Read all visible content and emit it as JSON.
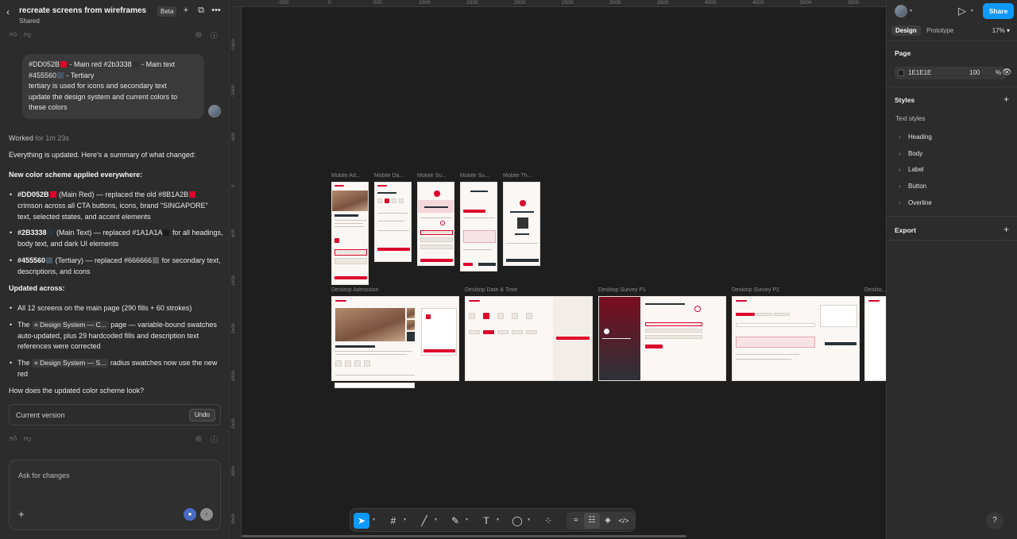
{
  "chat": {
    "title": "recreate screens from wireframes",
    "subtitle": "Shared",
    "beta": "Beta",
    "user_message": {
      "line1_a": "#DD052B",
      "line1_b": " - Main red #2b3338",
      "line1_c": " - Main text",
      "line2_a": "#455560",
      "line2_b": " - Tertiary",
      "line3": "tertiary is used for icons and secondary text",
      "line4": "update the design system and current colors to",
      "line5": "these colors"
    },
    "worked": "Worked",
    "worked_time": "for 1m 23s",
    "intro": "Everything is updated. Here's a summary of what changed:",
    "heading1": "New color scheme applied everywhere:",
    "bullets1": [
      {
        "code": "#DD052B",
        "text": " (Main Red) — replaced the old #8B1A2B",
        "tail": " crimson across all CTA buttons, icons, brand \"SINGAPORE\" text, selected states, and accent elements"
      },
      {
        "code": "#2B3338",
        "text": " (Main Text) — replaced #1A1A1A",
        "tail": " for all headings, body text, and dark UI elements"
      },
      {
        "code": "#455560",
        "text": " (Tertiary) — replaced #666666",
        "tail": " for secondary text, descriptions, and icons"
      }
    ],
    "heading2": "Updated across:",
    "bullets2": [
      {
        "pre": "All 12 screens on the main page (290 fills + 60 strokes)",
        "chip": "",
        "post": ""
      },
      {
        "pre": "The ",
        "chip": "⌗ Design System — C...",
        "post": " page — variable-bound swatches auto-updated, plus 29 hardcoded fills and description text references were corrected"
      },
      {
        "pre": "The ",
        "chip": "⌗ Design System — S...",
        "post": " radius swatches now use the new red"
      }
    ],
    "question": "How does the updated color scheme look?",
    "current_version": "Current version",
    "undo": "Undo",
    "input_placeholder": "Ask for changes",
    "colors": {
      "main_red": "#DD052B",
      "old_crimson": "#8B1A2B",
      "main_text": "#2B3338",
      "old_text": "#1A1A1A",
      "tertiary": "#455560",
      "old_tertiary": "#666666"
    }
  },
  "canvas": {
    "ruler_top": [
      "-500",
      "0",
      "500",
      "1000",
      "1500",
      "2000",
      "2500",
      "3000",
      "3500",
      "4000",
      "4500",
      "5000",
      "5500"
    ],
    "ruler_left": [
      "-1500",
      "-1000",
      "-500",
      "0",
      "500",
      "1000",
      "1500",
      "2000",
      "2500",
      "3000",
      "3500"
    ],
    "frames": [
      "Mobile Ad...",
      "Mobile Da...",
      "Mobile Su...",
      "Mobile Su...",
      "Mobile Th...",
      "Desktop Admission",
      "Desktop Date & Time",
      "Desktop Survey P1",
      "Desktop Survey P2",
      "Deskto..."
    ]
  },
  "toolbar": {
    "tools": [
      "move-tool",
      "frame-tool",
      "line-tool",
      "pen-tool",
      "text-tool",
      "comment-tool",
      "actions-tool",
      "draw-mode",
      "design-mode",
      "annotate-mode",
      "dev-mode"
    ]
  },
  "design_panel": {
    "share": "Share",
    "tab_design": "Design",
    "tab_prototype": "Prototype",
    "zoom": "17%",
    "page_heading": "Page",
    "page_color": "1E1E1E",
    "page_opacity": "100",
    "page_opacity_unit": "%",
    "styles_heading": "Styles",
    "text_styles": "Text styles",
    "style_items": [
      "Heading",
      "Body",
      "Label",
      "Button",
      "Overline"
    ],
    "export_heading": "Export",
    "help": "?"
  }
}
